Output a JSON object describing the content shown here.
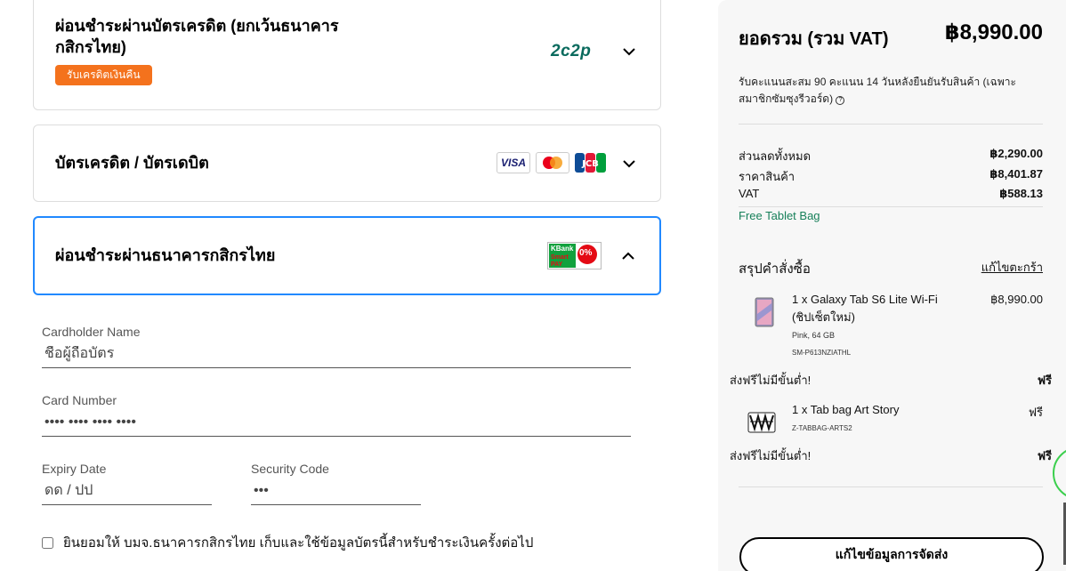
{
  "payment_options": {
    "installment_card": {
      "title_line1": "ผ่อนชำระผ่านบัตรเครดิต (ยกเว้นธนาคาร",
      "title_line2": "กสิกรไทย)",
      "badge": "รับเครดิตเงินคืน",
      "provider_logo": "2c2p"
    },
    "credit_debit": {
      "title": "บัตรเครดิต / บัตรเดบิต",
      "logos": [
        "VISA",
        "mastercard",
        "JCB"
      ]
    },
    "kbank": {
      "title": "ผ่อนชำระผ่านธนาคารกสิกรไทย",
      "logo_text": "KBank",
      "logo_text2": "Smart PAY",
      "logo_percent": "0%"
    }
  },
  "form": {
    "cardholder_label": "Cardholder Name",
    "cardholder_placeholder": "ชื่อผู้ถือบัตร",
    "card_number_label": "Card Number",
    "card_number_placeholder": "•••• •••• •••• ••••",
    "expiry_label": "Expiry Date",
    "expiry_placeholder": "ดด / ปป",
    "security_label": "Security Code",
    "security_placeholder": "•••",
    "consent_text": "ยินยอมให้ บมจ.ธนาคารกสิกรไทย เก็บและใช้ข้อมูลบัตรนี้สำหรับชำระเงินครั้งต่อไป",
    "consent_checked": false
  },
  "summary": {
    "total_label": "ยอดรวม (รวม VAT)",
    "total_value": "฿8,990.00",
    "points_text": "รับคะแนนสะสม 90 คะแนน 14 วันหลังยืนยันรับสินค้า (เฉพาะสมาชิกซัมซุงรีวอร์ด)",
    "info_icon": "info-icon",
    "rows": [
      {
        "label": "ส่วนลดทั้งหมด",
        "value": "฿2,290.00"
      },
      {
        "label": "ราคาสินค้า",
        "value": "฿8,401.87"
      },
      {
        "label": "VAT",
        "value": "฿588.13"
      }
    ],
    "free_gift": "Free Tablet Bag",
    "order_title": "สรุปคำสั่งซื้อ",
    "edit_cart": "แก้ไขตะกร้า",
    "items": [
      {
        "name": "1 x Galaxy Tab S6 Lite Wi-Fi (ชิปเซ็ตใหม่)",
        "variant": "Pink, 64 GB",
        "sku": "SM-P613NZIATHL",
        "price": "฿8,990.00"
      },
      {
        "name": "1 x Tab bag Art Story",
        "sku": "Z-TABBAG-ARTS2",
        "price": "ฟรี"
      }
    ],
    "shipping": [
      {
        "label": "ส่งฟรีไม่มีขั้นต่ำ!",
        "value": "ฟรี"
      },
      {
        "label": "ส่งฟรีไม่มีขั้นต่ำ!",
        "value": "ฟรี"
      }
    ],
    "shipping_button": "แก้ไขข้อมูลการจัดส่ง"
  },
  "colors": {
    "accent_blue": "#2189ff",
    "badge_orange": "#f4721d",
    "gift_green": "#17805a"
  }
}
